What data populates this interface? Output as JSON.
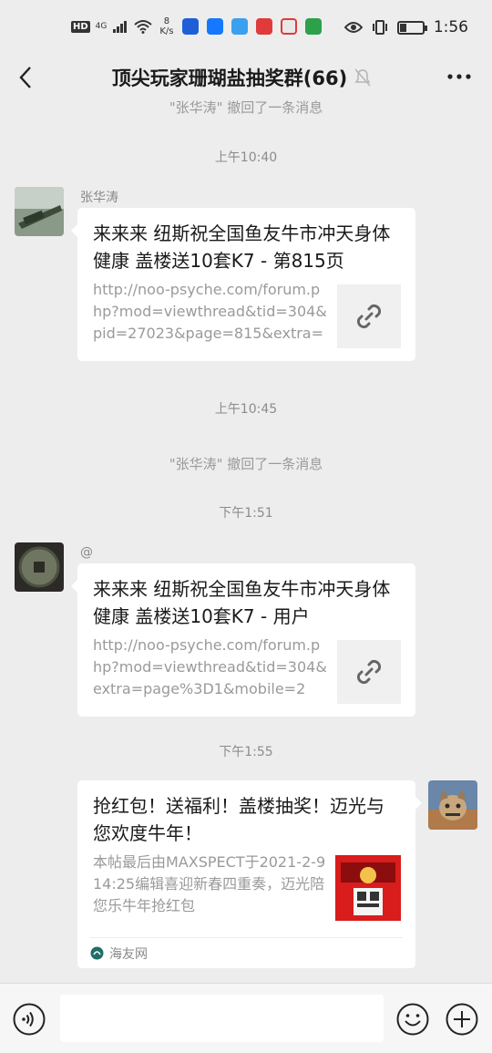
{
  "status_bar": {
    "hd": "HD",
    "network": "4G",
    "speed_value": "8",
    "speed_unit": "K/s",
    "time": "1:56"
  },
  "header": {
    "title": "顶尖玩家珊瑚盐抽奖群(66)",
    "icons": [
      "back-icon",
      "mute-bell-icon",
      "more-icon"
    ]
  },
  "chat": {
    "partial_notice": "\"张华涛\" 撤回了一条消息",
    "messages": [
      {
        "time": "上午10:40",
        "sender": "张华涛",
        "card_title": "来来来 纽斯祝全国鱼友牛市冲天身体健康 盖楼送10套K7 - 第815页",
        "card_desc": "http://noo-psyche.com/forum.php?mod=viewthread&tid=304&pid=27023&page=815&extra=",
        "thumb_icon": "link-icon"
      },
      {
        "time": "上午10:45",
        "notice": "\"张华涛\" 撤回了一条消息"
      },
      {
        "time": "下午1:51",
        "sender": "@",
        "card_title": "来来来 纽斯祝全国鱼友牛市冲天身体健康 盖楼送10套K7 - 用户",
        "card_desc": "http://noo-psyche.com/forum.php?mod=viewthread&tid=304&extra=page%3D1&mobile=2",
        "thumb_icon": "link-icon"
      },
      {
        "time": "下午1:55",
        "card_title": "抢红包！送福利！盖楼抽奖！迈光与您欢度牛年！",
        "card_desc": "本帖最后由MAXSPECT于2021-2-914:25编辑喜迎新春四重奏，迈光陪您乐牛年抢红包",
        "source": "海友网"
      }
    ]
  },
  "input_bar": {
    "placeholder": "",
    "icons": [
      "voice-icon",
      "emoji-icon",
      "plus-icon"
    ]
  },
  "colors": {
    "background": "#ededed",
    "bubble": "#ffffff",
    "muted_text": "#9a9a9a"
  }
}
